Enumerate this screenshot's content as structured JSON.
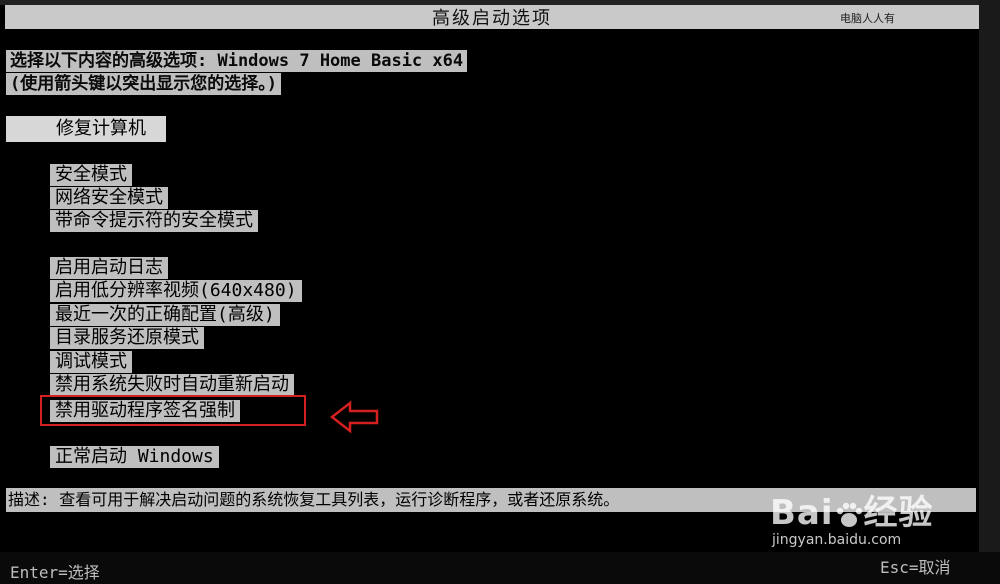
{
  "window": {
    "title": "高级启动选项",
    "brand": "电脑人人有"
  },
  "header": {
    "line1": "选择以下内容的高级选项: Windows 7 Home Basic x64",
    "line2": "(使用箭头键以突出显示您的选择。)"
  },
  "menu": {
    "selected": "修复计算机",
    "group1": [
      "安全模式",
      "网络安全模式",
      "带命令提示符的安全模式"
    ],
    "group2": [
      "启用启动日志",
      "启用低分辨率视频(640x480)",
      "最近一次的正确配置(高级)",
      "目录服务还原模式",
      "调试模式",
      "禁用系统失败时自动重新启动",
      "禁用驱动程序签名强制"
    ],
    "normal_start": "正常启动 Windows"
  },
  "description": "描述: 查看可用于解决启动问题的系统恢复工具列表，运行诊断程序，或者还原系统。",
  "footer": {
    "enter": "Enter=选择",
    "esc": "Esc=取消"
  },
  "watermark": {
    "logo": "Bai",
    "logo_suffix": "经验",
    "url": "jingyan.baidu.com"
  },
  "colors": {
    "highlight": "#d42020",
    "menu_bg": "#bfbfbf"
  },
  "icons": [
    "left-arrow-icon",
    "baidu-paw-icon"
  ]
}
